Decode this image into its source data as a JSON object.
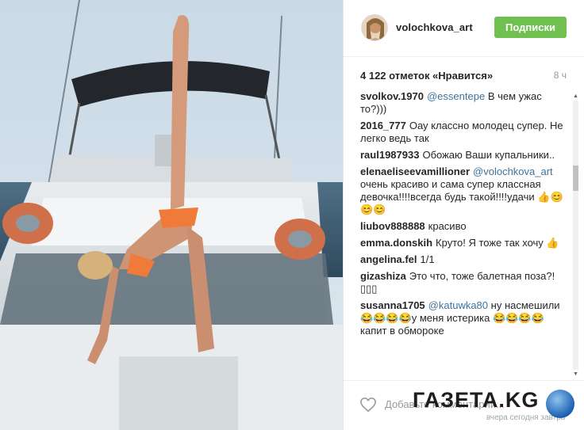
{
  "post": {
    "username": "volochkova_art",
    "follow_label": "Подписки",
    "likes": "4 122 отметок «Нравится»",
    "time_ago": "8 ч"
  },
  "comments": [
    {
      "user": "svolkov.1970",
      "mention": "@essentepe",
      "text": "В чем ужас то?)))"
    },
    {
      "user": "2016_777",
      "mention": "",
      "text": "Оау классно молодец супер. Не легко ведь так"
    },
    {
      "user": "raul1987933",
      "mention": "",
      "text": "Обожаю Ваши купальники.."
    },
    {
      "user": "elenaeliseevamillioner",
      "mention": "@volochkova_art",
      "text": "очень красиво и сама супер классная девочка!!!!всегда будь такой!!!!удачи 👍😊😊😊"
    },
    {
      "user": "liubov888888",
      "mention": "",
      "text": "красиво"
    },
    {
      "user": "emma.donskih",
      "mention": "",
      "text": "Круто! Я тоже так хочу 👍"
    },
    {
      "user": "angelina.fel",
      "mention": "",
      "text": "1/1"
    },
    {
      "user": "gizashiza",
      "mention": "",
      "text": "Это что, тоже балетная поза?!▯▯▯"
    },
    {
      "user": "susanna1705",
      "mention": "@katuwka80",
      "text": "ну насмешили😂😂😂😂у меня истерика 😂😂😂😂капит в обмороке"
    }
  ],
  "add_comment_placeholder": "Добавьте комментарий...",
  "watermark": {
    "logo": "ГАЗЕТА.KG",
    "tagline": "вчера сегодня завтра"
  },
  "icons": {
    "heart": "heart-icon",
    "globe": "globe-icon",
    "scroll_up": "scroll-up-icon",
    "scroll_down": "scroll-down-icon"
  },
  "colors": {
    "follow": "#70c050",
    "mention": "#3f729b",
    "text": "#262626",
    "muted": "#999999"
  }
}
